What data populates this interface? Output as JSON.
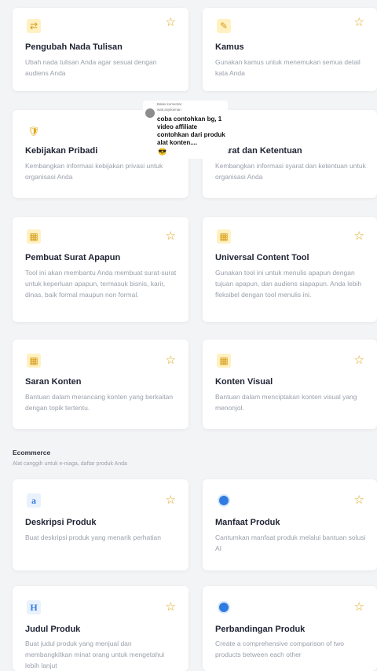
{
  "cards": [
    {
      "title": "Pengubah Nada Tulisan",
      "desc": "Ubah nada tulisan Anda agar sesuai dengan audiens Anda",
      "icon": "text-tone-icon",
      "glyph": "⇄"
    },
    {
      "title": "Kamus",
      "desc": "Gunakan kamus untuk menemukan semua detail kata Anda",
      "icon": "dictionary-icon",
      "glyph": "✎"
    },
    {
      "title": "Kebijakan Pribadi",
      "desc": "Kembangkan informasi kebijakan privasi untuk organisasi Anda",
      "icon": "shield-icon",
      "glyph": "🛡"
    },
    {
      "title": "…arat dan Ketentuan",
      "desc": "Kembangkan informasi syarat dan ketentuan untuk organisasi Anda",
      "icon": "document-icon",
      "glyph": ""
    },
    {
      "title": "Pembuat Surat Apapun",
      "desc": "Tool ini akan membantu Anda membuat surat-surat untuk keperluan apapun, termasuk bisnis, karir, dinas, baik formal maupun non formal.",
      "icon": "grid-icon",
      "glyph": "▦"
    },
    {
      "title": "Universal Content Tool",
      "desc": "Gunakan tool ini untuk menulis apapun dengan tujuan apapun, dan audiens siapapun. Anda lebih fleksibel dengan tool menulis ini.",
      "icon": "grid-icon",
      "glyph": "▦"
    },
    {
      "title": "Saran Konten",
      "desc": "Bantuan dalam merancang konten yang berkaitan dengan topik tertentu.",
      "icon": "grid-icon",
      "glyph": "▦"
    },
    {
      "title": "Konten Visual",
      "desc": "Bantuan dalam menciptakan konten visual yang menonjol.",
      "icon": "grid-icon",
      "glyph": "▦"
    },
    {
      "title": "Deskripsi Produk",
      "desc": "Buat deskripsi produk yang menarik perhatian",
      "icon": "amazon-icon",
      "glyph": "a"
    },
    {
      "title": "Manfaat Produk",
      "desc": "Cantumkan manfaat produk melalui bantuan solusi AI",
      "icon": "product-icon",
      "glyph": ""
    },
    {
      "title": "Judul Produk",
      "desc": "Buat judul produk yang menjual dan membangkitkan minat orang untuk mengetahui lebih lanjut",
      "icon": "heading-icon",
      "glyph": "H"
    },
    {
      "title": "Perbandingan Produk",
      "desc": "Create a comprehensive comparison of two products between each other",
      "icon": "compare-icon",
      "glyph": ""
    }
  ],
  "section": {
    "title": "Ecommerce",
    "subtitle": "Alat canggih untuk e-niaga, daftar produk Anda"
  },
  "star_glyph": "☆",
  "comment_overlay": {
    "meta_line1": "Balas komentar",
    "meta_line2": "wak.asyikaman",
    "text": "coba contohkan bg, 1 video affiliate contohkan dari produk alat konten....",
    "emoji": "😎"
  }
}
